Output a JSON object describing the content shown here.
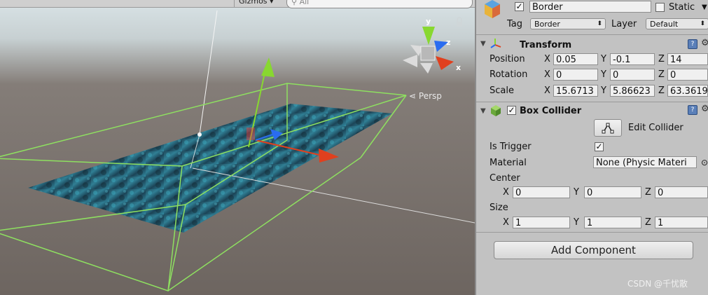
{
  "scene": {
    "gizmos_label": "Gizmos",
    "search_placeholder": "All",
    "persp_label": "Persp",
    "axis_labels": {
      "y": "y",
      "z": "z",
      "x": "x"
    }
  },
  "inspector": {
    "object": {
      "name": "Border",
      "active_checked": true,
      "static_label": "Static",
      "tag_label": "Tag",
      "tag_value": "Border",
      "layer_label": "Layer",
      "layer_value": "Default"
    },
    "transform": {
      "title": "Transform",
      "position_label": "Position",
      "rotation_label": "Rotation",
      "scale_label": "Scale",
      "axis_x": "X",
      "axis_y": "Y",
      "axis_z": "Z",
      "position": {
        "x": "0.05",
        "y": "-0.1",
        "z": "14"
      },
      "rotation": {
        "x": "0",
        "y": "0",
        "z": "0"
      },
      "scale": {
        "x": "15.6713",
        "y": "5.86623",
        "z": "63.3619"
      }
    },
    "box_collider": {
      "title": "Box Collider",
      "enabled": true,
      "edit_collider_label": "Edit Collider",
      "is_trigger_label": "Is Trigger",
      "is_trigger_checked": true,
      "material_label": "Material",
      "material_value": "None (Physic Materi",
      "center_label": "Center",
      "center": {
        "x": "0",
        "y": "0",
        "z": "0"
      },
      "size_label": "Size",
      "size": {
        "x": "1",
        "y": "1",
        "z": "1"
      }
    },
    "add_component_label": "Add Component"
  },
  "watermark": "CSDN @千忧散",
  "colors": {
    "collider_wire": "#8ee060",
    "axis_x": "#e0401e",
    "axis_y": "#88d830",
    "axis_z": "#2a6cf0",
    "inspector_bg": "#c2c2c2"
  }
}
